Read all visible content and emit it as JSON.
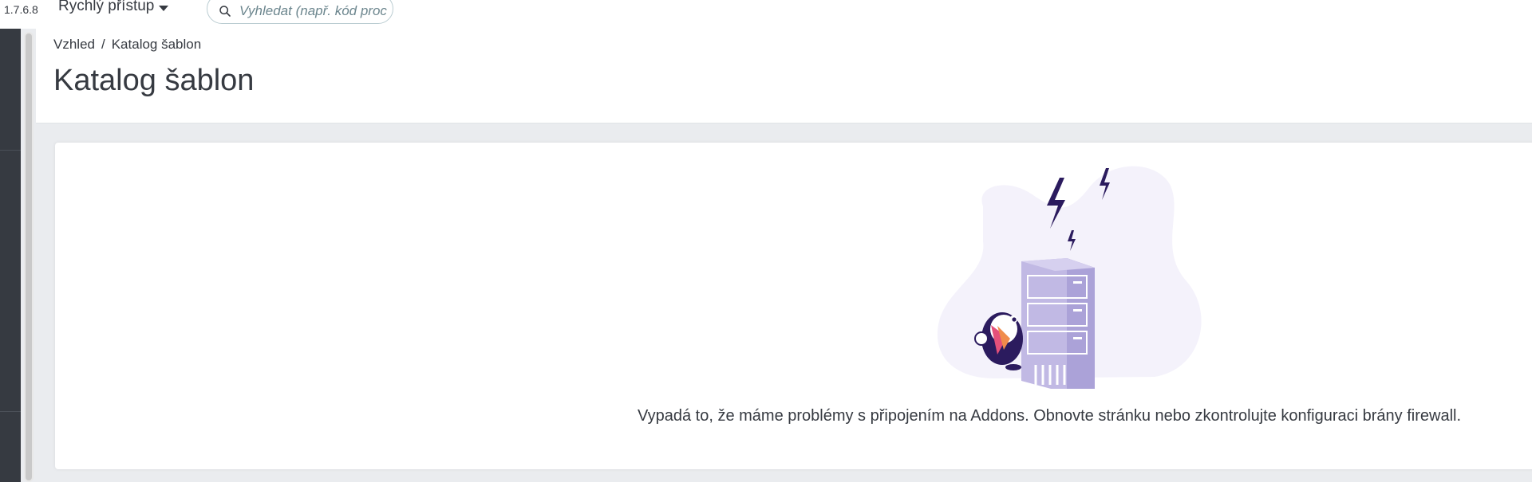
{
  "topbar": {
    "version": "1.7.6.8",
    "quick_access_label": "Rychlý přístup",
    "search_placeholder": "Vyhledat (např. kód proc"
  },
  "header": {
    "breadcrumb": [
      "Vzhled",
      "/",
      "Katalog šablon"
    ],
    "title": "Katalog šablon"
  },
  "main": {
    "error_message": "Vypadá to, že máme problémy s připojením na Addons. Obnovte stránku nebo zkontrolujte konfiguraci brány firewall.",
    "illustration_icon": "puffin-server-error-illustration"
  },
  "colors": {
    "sidebar": "#363a41",
    "illustration_purple": "#c1b9e4",
    "bolt": "#2b1b5e",
    "background": "#eaecef"
  }
}
